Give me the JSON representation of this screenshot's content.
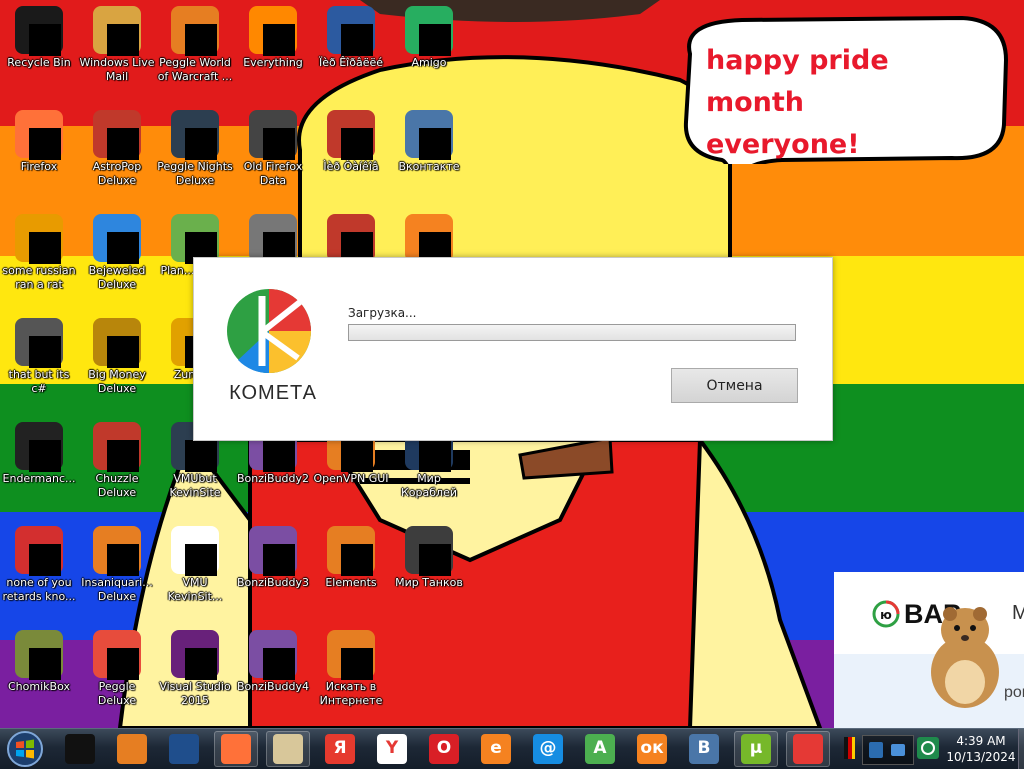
{
  "speech_bubble": {
    "line1": "happy pride month",
    "line2": "everyone!"
  },
  "desktop_icons": [
    {
      "label": "Recycle Bin",
      "icon": "recycle-bin-icon",
      "color": "#1a1a1a"
    },
    {
      "label": "Firefox",
      "icon": "firefox-icon",
      "color": "#ff7139"
    },
    {
      "label": "some russian ran a rat",
      "icon": "ae-app-icon",
      "color": "#e89b00"
    },
    {
      "label": "that but its c#",
      "icon": "stack-icon",
      "color": "#555555"
    },
    {
      "label": "Endermanc...",
      "icon": "console-icon",
      "color": "#222222"
    },
    {
      "label": "none of you retards kno...",
      "icon": "opera-style-icon",
      "color": "#d32f2f"
    },
    {
      "label": "ChomikBox",
      "icon": "chomikbox-icon",
      "color": "#7a8a3a"
    },
    {
      "label": "Windows Live Mail",
      "icon": "mail-icon",
      "color": "#d9a441"
    },
    {
      "label": "AstroPop Deluxe",
      "icon": "astropop-icon",
      "color": "#c0392b"
    },
    {
      "label": "Bejeweled Deluxe",
      "icon": "bejeweled-icon",
      "color": "#2e86de"
    },
    {
      "label": "Big Money Deluxe",
      "icon": "money-bag-icon",
      "color": "#b8860b"
    },
    {
      "label": "Chuzzle Deluxe",
      "icon": "chuzzle-icon",
      "color": "#c0392b"
    },
    {
      "label": "Insaniquari... Deluxe",
      "icon": "fish-icon",
      "color": "#e67e22"
    },
    {
      "label": "Peggle Deluxe",
      "icon": "peggle-icon",
      "color": "#e74c3c"
    },
    {
      "label": "Peggle World of Warcraft ...",
      "icon": "peggle-wow-icon",
      "color": "#e67e22"
    },
    {
      "label": "Peggle Nights Deluxe",
      "icon": "peggle-nights-icon",
      "color": "#2c3e50"
    },
    {
      "label": "Plan... Zon...",
      "icon": "plants-zombies-icon",
      "color": "#6ab04c"
    },
    {
      "label": "Zuma...",
      "icon": "zuma-icon",
      "color": "#e1a100"
    },
    {
      "label": "VMUbut KevinSite",
      "icon": "vm-icon",
      "color": "#2c3e50"
    },
    {
      "label": "VMU KevinSit...",
      "icon": "file-icon",
      "color": "#ffffff"
    },
    {
      "label": "Visual Studio 2015",
      "icon": "visual-studio-icon",
      "color": "#68217a"
    },
    {
      "label": "Everything",
      "icon": "everything-search-icon",
      "color": "#ff8800"
    },
    {
      "label": "Old Firefox Data",
      "icon": "folder-icon",
      "color": "#444444"
    },
    {
      "label": "",
      "icon": "folder-icon",
      "color": "#777777"
    },
    {
      "label": "",
      "icon": "blank-icon",
      "color": "#cccccc"
    },
    {
      "label": "BonziBuddy2",
      "icon": "bonzibuddy-icon",
      "color": "#7b4ea3"
    },
    {
      "label": "BonziBuddy3",
      "icon": "bonzibuddy-icon",
      "color": "#7b4ea3"
    },
    {
      "label": "BonziBuddy4",
      "icon": "bonzibuddy-icon",
      "color": "#7b4ea3"
    },
    {
      "label": "Ïèð Êîðâëëé",
      "icon": "shield-app-icon",
      "color": "#2c5aa0"
    },
    {
      "label": "Ìèð Òàíêîâ",
      "icon": "tank-icon",
      "color": "#c0392b"
    },
    {
      "label": "",
      "icon": "ccleaner-icon",
      "color": "#c0392b"
    },
    {
      "label": "",
      "icon": "blank-icon",
      "color": "#cccccc"
    },
    {
      "label": "OpenVPN GUI",
      "icon": "openvpn-icon",
      "color": "#e67e22"
    },
    {
      "label": "Elements",
      "icon": "elements-icon",
      "color": "#e67e22"
    },
    {
      "label": "Искать в Интернете",
      "icon": "search-internet-icon",
      "color": "#e67e22"
    },
    {
      "label": "Amigo",
      "icon": "amigo-icon",
      "color": "#27ae60"
    },
    {
      "label": "Вконтакте",
      "icon": "vk-icon",
      "color": "#4a76a8"
    },
    {
      "label": "",
      "icon": "odnoklassniki-icon",
      "color": "#f58220"
    },
    {
      "label": "",
      "icon": "blank-icon",
      "color": "#cccccc"
    },
    {
      "label": "Мир Кораблей",
      "icon": "ship-icon",
      "color": "#1f3a5f"
    },
    {
      "label": "Мир Танков",
      "icon": "tank-icon",
      "color": "#3d3d3d"
    }
  ],
  "loader": {
    "brand": "КОМЕТА",
    "loading_text": "Загрузка...",
    "progress": 0,
    "cancel_label": "Отмена",
    "accent": "#2ea043"
  },
  "ad": {
    "brand": "BAP",
    "badge": "ю",
    "partial_title": "М",
    "partial_text": "рои"
  },
  "taskbar": {
    "pinned": [
      {
        "name": "terminal",
        "icon": "terminal-icon",
        "color": "#111111",
        "text": ""
      },
      {
        "name": "media-player",
        "icon": "media-player-icon",
        "color": "#e67e22",
        "text": ""
      },
      {
        "name": "globe",
        "icon": "globe-icon",
        "color": "#1f4e8c",
        "text": ""
      },
      {
        "name": "firefox",
        "icon": "firefox-icon",
        "color": "#ff7139",
        "text": ""
      },
      {
        "name": "notepad",
        "icon": "notepad-icon",
        "color": "#d8c79a",
        "text": ""
      },
      {
        "name": "yandex",
        "icon": "yandex-icon",
        "color": "#e63a2e",
        "text": "Я"
      },
      {
        "name": "yandex-browser",
        "icon": "yandex-browser-icon",
        "color": "#ffffff",
        "text": "Y"
      },
      {
        "name": "opera",
        "icon": "opera-icon",
        "color": "#d91f26",
        "text": "O"
      },
      {
        "name": "origin-like",
        "icon": "origin-icon",
        "color": "#f58220",
        "text": "e"
      },
      {
        "name": "mail-ru",
        "icon": "mail-ru-icon",
        "color": "#168de2",
        "text": "@"
      },
      {
        "name": "font-app",
        "icon": "font-app-icon",
        "color": "#4caf50",
        "text": "A"
      },
      {
        "name": "odnoklassniki",
        "icon": "odnoklassniki-icon",
        "color": "#f58220",
        "text": "ок"
      },
      {
        "name": "vkontakte",
        "icon": "vk-icon",
        "color": "#4a76a8",
        "text": "В"
      },
      {
        "name": "utorrent",
        "icon": "utorrent-icon",
        "color": "#76b82a",
        "text": "µ"
      },
      {
        "name": "kometa",
        "icon": "kometa-icon",
        "color": "#e53935",
        "text": ""
      }
    ],
    "clock_time": "4:39 AM",
    "clock_date": "10/13/2024"
  }
}
